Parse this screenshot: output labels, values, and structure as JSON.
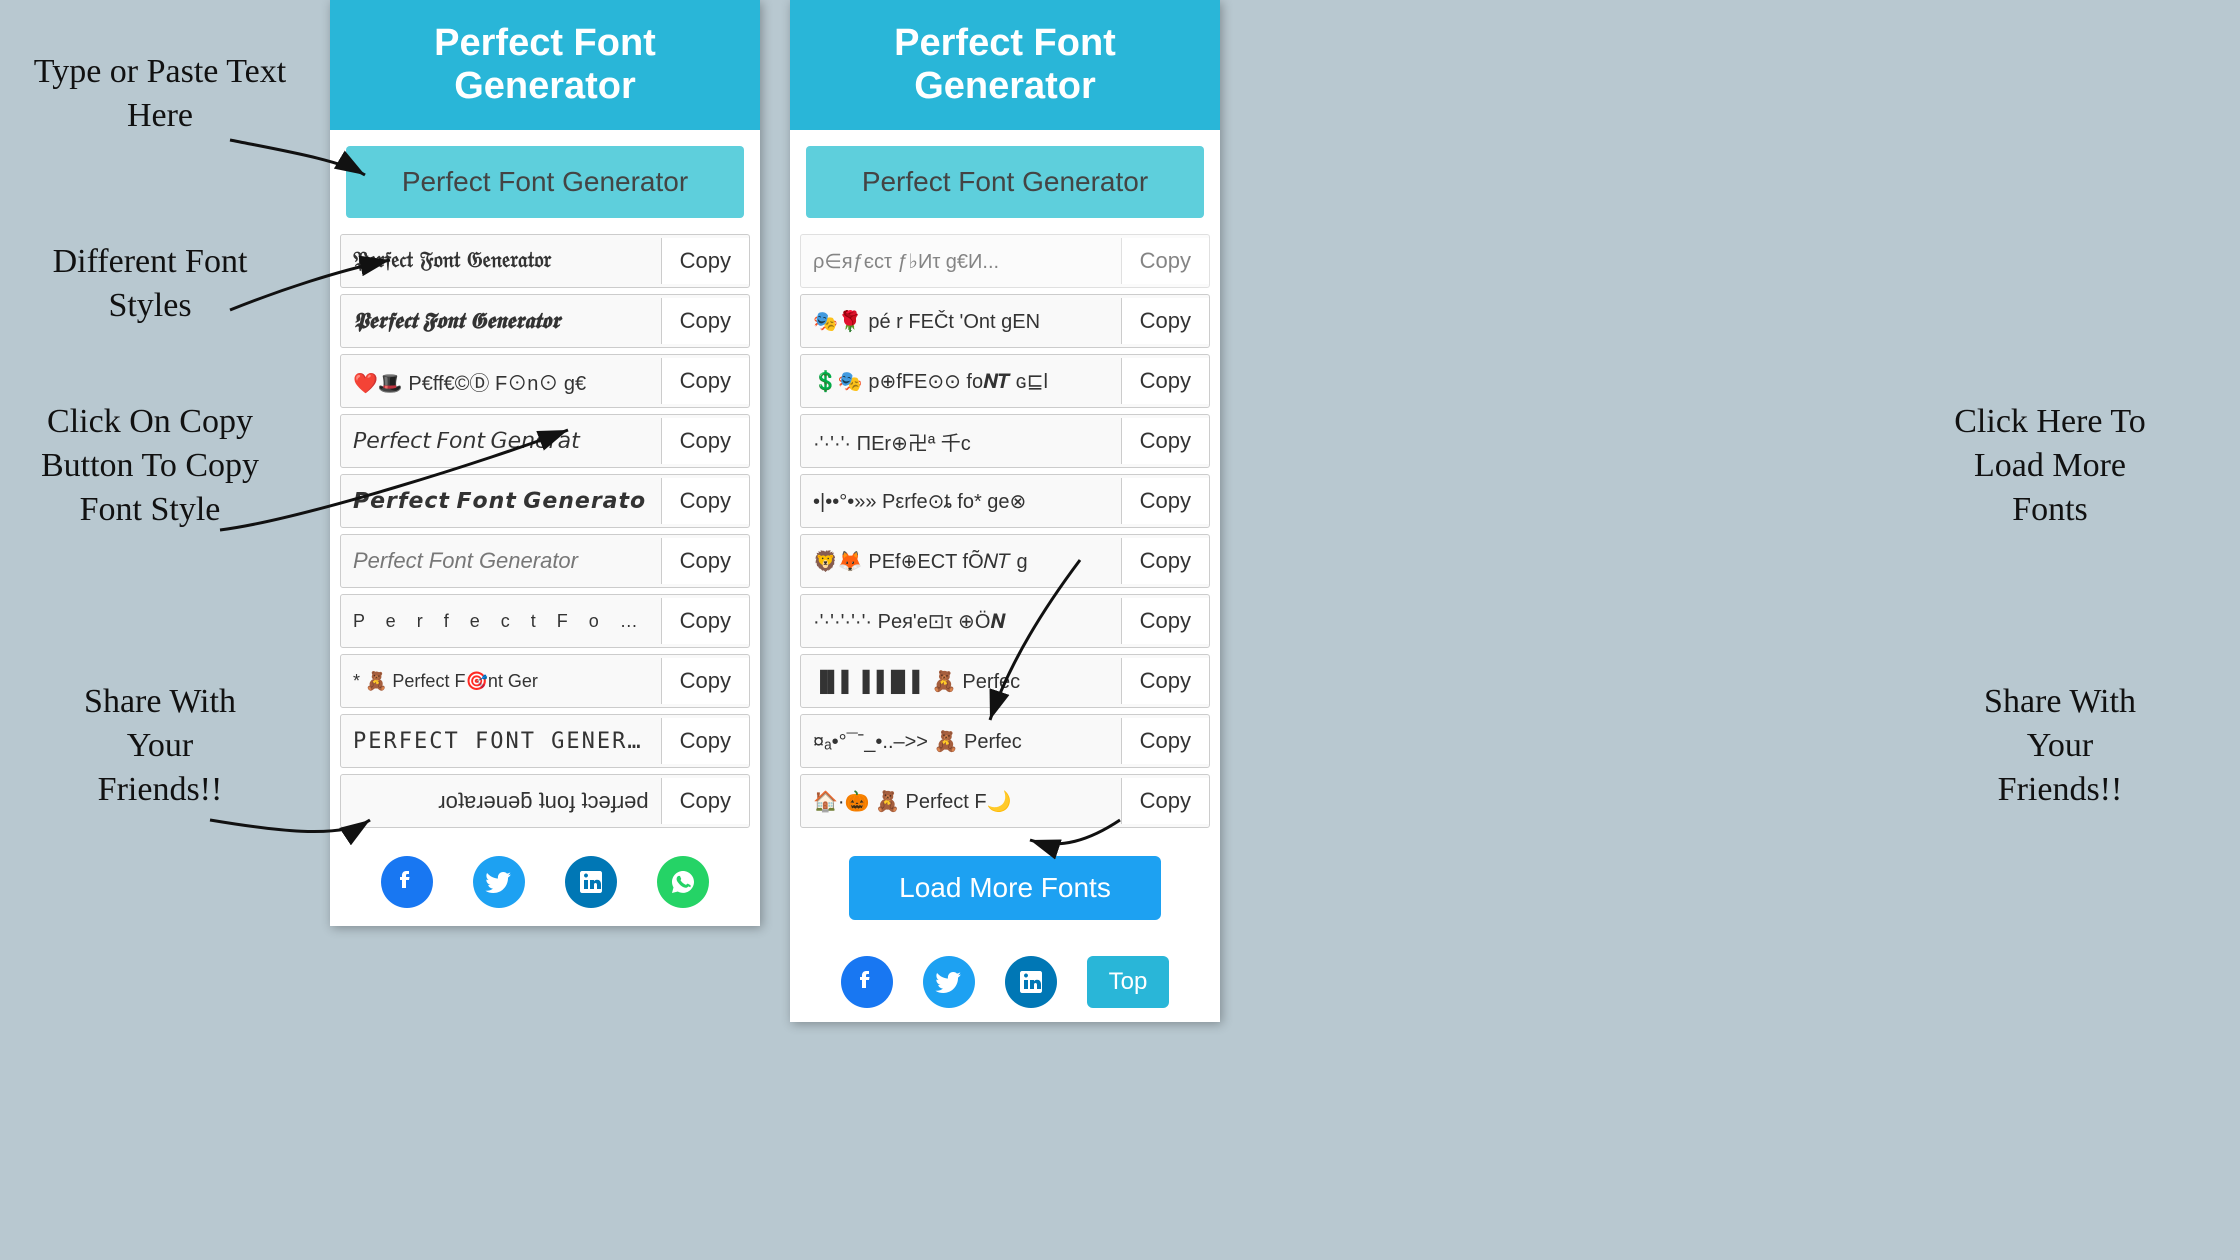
{
  "app": {
    "title": "Perfect Font Generator"
  },
  "left_phone": {
    "header": "Perfect Font Generator",
    "input_value": "Perfect Font Generator",
    "input_placeholder": "Type or Paste Text Here",
    "fonts": [
      {
        "id": 1,
        "text": "𝔓𝔢𝔯𝔣𝔢𝔠𝔱 𝔉𝔬𝔫𝔱 𝔊𝔢𝔫𝔢𝔯𝔞𝔱𝔬𝔯",
        "style": "f1",
        "copy_label": "Copy"
      },
      {
        "id": 2,
        "text": "𝕻𝖊𝖗𝖋𝖊𝖈𝖙 𝕱𝖔𝖓𝖙 𝕲𝖊𝖓𝖊𝖗𝖆𝖙𝖔𝖗",
        "style": "f2",
        "copy_label": "Copy"
      },
      {
        "id": 3,
        "text": "❤️🎩 P€ff€©Ⓓ F⊙n⊙ g€",
        "style": "f3",
        "copy_label": "Copy"
      },
      {
        "id": 4,
        "text": "𝘗𝘦𝘳𝘧𝘦𝘤𝘵 𝘍𝘰𝘯𝘵 𝘎𝘦𝘯𝘦𝘳𝘢𝘵",
        "style": "f4",
        "copy_label": "Copy"
      },
      {
        "id": 5,
        "text": "𝙋𝙚𝙧𝙛𝙚𝙘𝙩 𝙁𝙤𝙣𝙩 𝙂𝙚𝙣𝙚𝙧𝙖𝙩𝙤",
        "style": "f5",
        "copy_label": "Copy"
      },
      {
        "id": 6,
        "text": "Perfect Font Generator",
        "style": "f6",
        "copy_label": "Copy"
      },
      {
        "id": 7,
        "text": "P e r f e c t  F o n t",
        "style": "f7",
        "copy_label": "Copy"
      },
      {
        "id": 8,
        "text": "* 🧸 Perfect F🎯nt Ger",
        "style": "f8",
        "copy_label": "Copy"
      },
      {
        "id": 9,
        "text": "PERFECT FONT GENERATOR",
        "style": "f9",
        "copy_label": "Copy"
      },
      {
        "id": 10,
        "text": "ɹoʇɐɹǝuǝƃ ʇuoɟ ʇɔǝɟɹǝd",
        "style": "f10",
        "copy_label": "Copy"
      }
    ],
    "social": [
      {
        "name": "facebook",
        "icon": "f",
        "label": "Facebook"
      },
      {
        "name": "twitter",
        "icon": "t",
        "label": "Twitter"
      },
      {
        "name": "linkedin",
        "icon": "in",
        "label": "LinkedIn"
      },
      {
        "name": "whatsapp",
        "icon": "w",
        "label": "WhatsApp"
      }
    ]
  },
  "right_phone": {
    "header": "Perfect Font Generator",
    "input_value": "Perfect Font Generator",
    "fonts": [
      {
        "id": 1,
        "text": "ρ∈яƒєcτ ƒ♭Иτ g€И...",
        "style": "f3",
        "copy_label": "Copy"
      },
      {
        "id": 2,
        "text": "🎭🌹 pé r FEČt 'Ont gEN",
        "style": "f3",
        "copy_label": "Copy"
      },
      {
        "id": 3,
        "text": "💲🎭 p⊕fFE⊙⊙ fo𝑵𝑻 ɢ⊑l",
        "style": "f3",
        "copy_label": "Copy"
      },
      {
        "id": 4,
        "text": "·'·'·'· ΠЕr⊕卍ª 千c",
        "style": "f3",
        "copy_label": "Copy"
      },
      {
        "id": 5,
        "text": "•|••°•»» Pεrfe⊙ȶ fo* ge⊗",
        "style": "f3",
        "copy_label": "Copy"
      },
      {
        "id": 6,
        "text": "🦁🦊 PΕf⊕ЕCT fÕ𝑁𝑇 g",
        "style": "f3",
        "copy_label": "Copy"
      },
      {
        "id": 7,
        "text": "·'·'·'·'·'· Pея'е⊡τ ⊕Ö𝑵",
        "style": "f3",
        "copy_label": "Copy"
      },
      {
        "id": 8,
        "text": "▐▌▌▐▐▐▌▌ 🧸 Perfec",
        "style": "f3",
        "copy_label": "Copy"
      },
      {
        "id": 9,
        "text": "¤ₐ•°¯ˉ_•..–>> 🧸 Perfec",
        "style": "f3",
        "copy_label": "Copy"
      },
      {
        "id": 10,
        "text": "🏠·🎃 🧸 Perfect F🌙",
        "style": "f3",
        "copy_label": "Copy"
      }
    ],
    "load_more_label": "Load More Fonts",
    "top_label": "Top",
    "social": [
      {
        "name": "facebook",
        "label": "Facebook"
      },
      {
        "name": "twitter",
        "label": "Twitter"
      },
      {
        "name": "linkedin",
        "label": "LinkedIn"
      }
    ]
  },
  "annotations": {
    "type_paste": "Type or Paste Text\nHere",
    "different_fonts": "Different Font\nStyles",
    "click_copy": "Click On Copy\nButton To Copy\nFont Style",
    "share_left": "Share With\nYour\nFriends!!",
    "click_load": "Click Here To\nLoad More\nFonts",
    "share_right": "Share With\nYour\nFriends!!"
  }
}
